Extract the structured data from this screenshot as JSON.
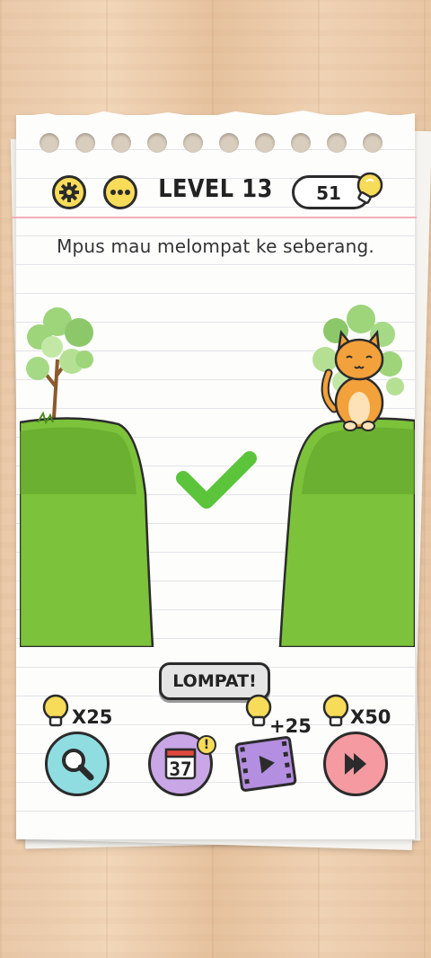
{
  "header": {
    "level_label": "LEVEL 13",
    "hint_count": "51",
    "settings_icon": "gear-icon",
    "more_icon": "more-dots-icon",
    "bulb_icon": "lightbulb-icon"
  },
  "question": {
    "text": "Mpus mau melompat ke seberang."
  },
  "scene": {
    "result_icon": "checkmark-icon",
    "character": "cat",
    "colors": {
      "grass": "#7cc23a",
      "grass_dark": "#5da32a",
      "check": "#5cc43a",
      "cat": "#f2a13b"
    }
  },
  "action": {
    "label": "LOMPAT!"
  },
  "tools": [
    {
      "name": "search",
      "icon": "magnifier-icon",
      "cost": "X25",
      "color": "#8fdde0"
    },
    {
      "name": "calendar",
      "icon": "calendar-icon",
      "day": "37",
      "badge": "!",
      "color": "#c9a6e6"
    },
    {
      "name": "video",
      "icon": "video-play-icon",
      "reward": "+25",
      "color": "#b48ee0"
    },
    {
      "name": "skip",
      "icon": "skip-forward-icon",
      "cost": "X50",
      "color": "#f49aa0"
    }
  ]
}
